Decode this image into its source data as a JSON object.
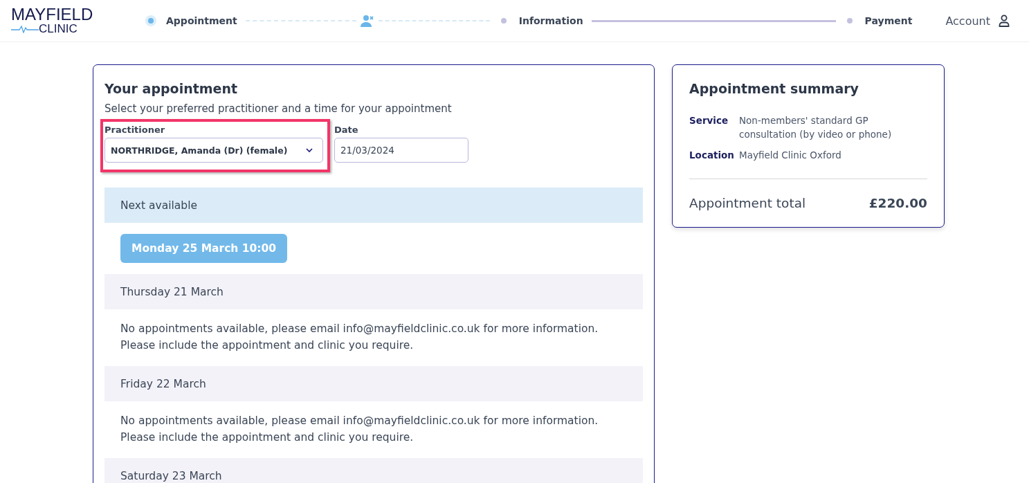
{
  "logo": {
    "line_1": "MAYFIELD",
    "line_2": "CLINIC"
  },
  "steps": [
    {
      "label": "Appointment",
      "selected": true
    },
    {
      "label": "Information",
      "selected": false
    },
    {
      "label": "Payment",
      "selected": false
    }
  ],
  "connectors": [
    {
      "kind": "dashed"
    },
    {
      "kind": "solid"
    }
  ],
  "account": {
    "label": "Account"
  },
  "appointment": {
    "title": "Your appointment",
    "subtitle": "Select your preferred practitioner and a time for your appointment",
    "practitioner": {
      "label": "Practitioner",
      "value": "NORTHRIDGE, Amanda (Dr) (female)",
      "highlighted": true
    },
    "date": {
      "label": "Date",
      "value": "21/03/2024"
    },
    "days": [
      {
        "kind": "next",
        "heading": "Next available",
        "slots": [
          "Monday 25 March 10:00"
        ]
      },
      {
        "kind": "day",
        "heading": "Thursday 21 March",
        "message": "No appointments available, please email info@mayfieldclinic.co.uk for more information. Please include the appointment and clinic you require."
      },
      {
        "kind": "day",
        "heading": "Friday 22 March",
        "message": "No appointments available, please email info@mayfieldclinic.co.uk for more information. Please include the appointment and clinic you require."
      },
      {
        "kind": "day",
        "heading": "Saturday 23 March"
      }
    ]
  },
  "summary": {
    "title": "Appointment summary",
    "rows": [
      {
        "label": "Service",
        "value": "Non-members' standard GP consultation (by video or phone)"
      },
      {
        "label": "Location",
        "value": "Mayfield Clinic Oxford"
      }
    ],
    "total_label": "Appointment total",
    "total": "£220.00"
  }
}
